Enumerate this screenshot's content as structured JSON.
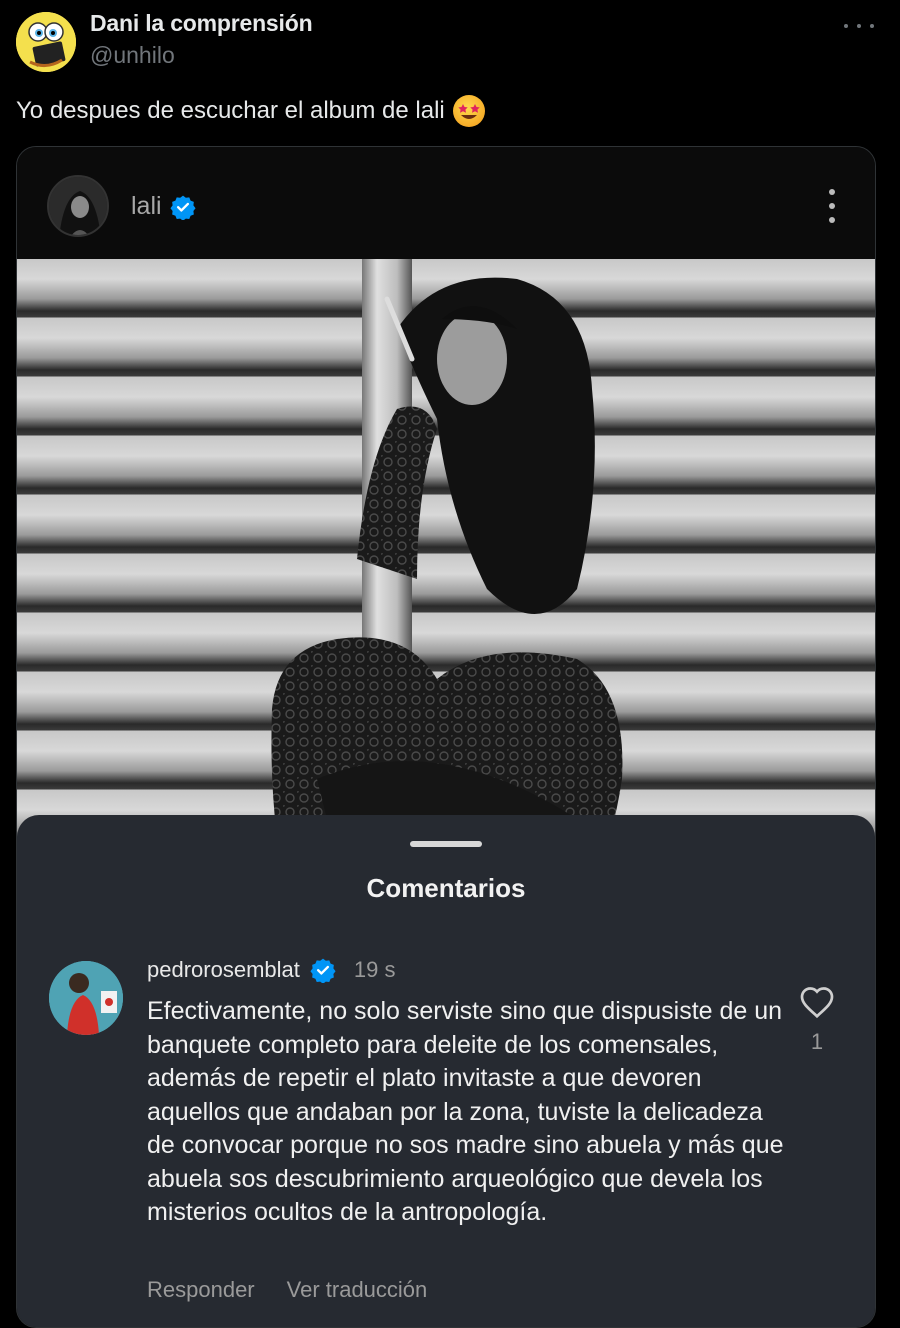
{
  "tweet": {
    "author_name": "Dani la comprensión",
    "author_handle": "@unhilo",
    "text": "Yo despues de escuchar el album de lali",
    "emoji_icon": "star-struck-emoji-icon"
  },
  "embed": {
    "post_user": "lali",
    "comments_title": "Comentarios",
    "comment": {
      "user": "pedrorosemblat",
      "time": "19 s",
      "text": "Efectivamente, no solo serviste sino que dispusiste de un banquete completo para deleite de los comensales, además de repetir el plato invitaste a que devoren aquellos que andaban por la zona, tuviste la delicadeza de convocar porque no sos madre sino abuela y más que abuela sos descubrimiento arqueológico que devela los misterios ocultos de la antropología.",
      "reply_label": "Responder",
      "translate_label": "Ver traducción",
      "like_count": "1"
    }
  },
  "colors": {
    "background": "#000000",
    "sheet": "#262a31",
    "verified": "#0095f6",
    "muted": "#71767b"
  }
}
